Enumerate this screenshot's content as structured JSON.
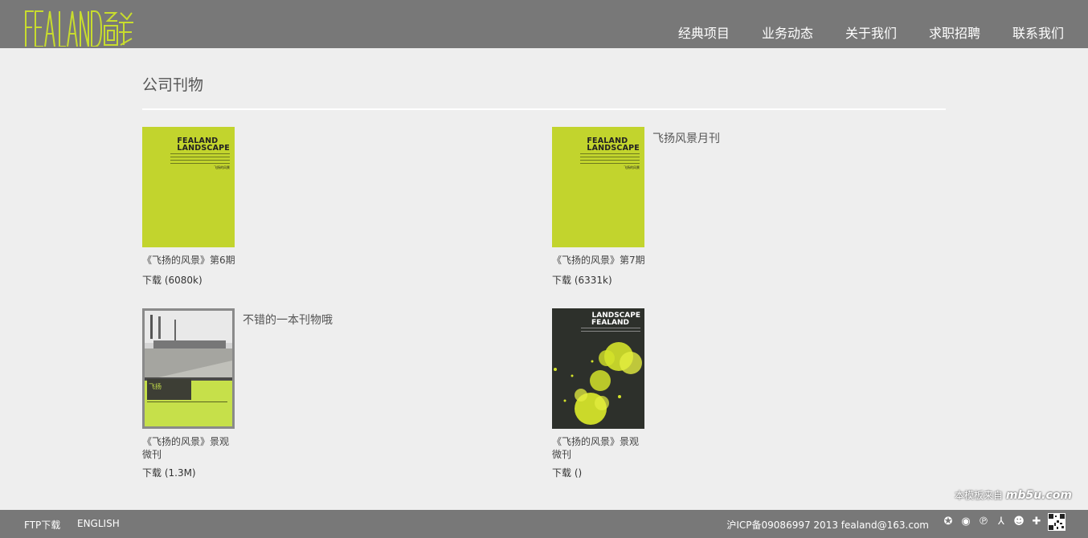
{
  "header": {
    "logo_alt": "FEALAND 飞扬",
    "nav": [
      "经典项目",
      "业务动态",
      "关于我们",
      "求职招聘",
      "联系我们"
    ]
  },
  "page": {
    "title": "公司刊物"
  },
  "publications": [
    {
      "name": "《飞扬的风景》第6期",
      "download": "下载 (6080k)",
      "desc": "",
      "cover_title": [
        "FEALAND",
        "LANDSCAPE"
      ],
      "cover_issue": "飞扬的风景"
    },
    {
      "name": "《飞扬的风景》第7期",
      "download": "下载 (6331k)",
      "desc": "飞扬风景月刊",
      "cover_title": [
        "FEALAND",
        "LANDSCAPE"
      ],
      "cover_issue": "飞扬的风景"
    },
    {
      "name": "《飞扬的风景》景观微刊",
      "download": "下载 (1.3M)",
      "desc": "不错的一本刊物哦",
      "cover_brand": "飞扬"
    },
    {
      "name": "《飞扬的风景》景观微刊",
      "download": "下载 ()",
      "desc": "",
      "cover_title": [
        "LANDSCAPE",
        "FEALAND"
      ]
    }
  ],
  "footer": {
    "ftp": "FTP下载",
    "english": "ENGLISH",
    "copyright": "沪ICP备09086997 2013 fealand@163.com",
    "social_icons": [
      "xing-icon",
      "weibo-icon",
      "qzone-icon",
      "renren-icon",
      "kaixin-icon",
      "plus-icon",
      "qrcode-icon"
    ],
    "watermark_prefix": "本模板来自",
    "watermark_brand": "mb5u.com"
  },
  "colors": {
    "accent": "#c2d42d",
    "header_bg": "#787878",
    "page_bg": "#eeeeee"
  }
}
